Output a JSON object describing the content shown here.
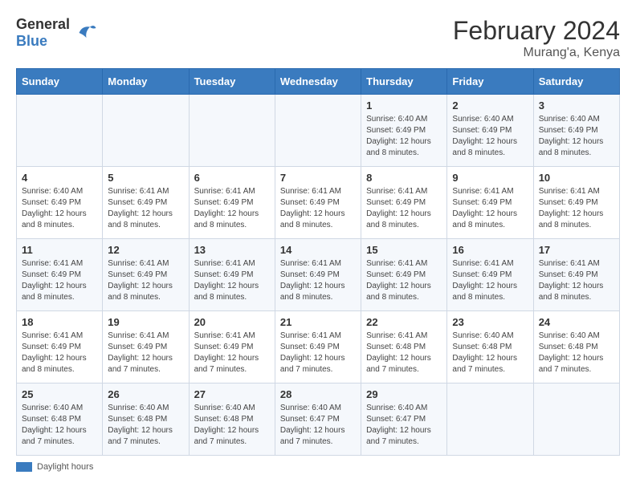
{
  "header": {
    "logo_general": "General",
    "logo_blue": "Blue",
    "title": "February 2024",
    "subtitle": "Murang'a, Kenya"
  },
  "days_of_week": [
    "Sunday",
    "Monday",
    "Tuesday",
    "Wednesday",
    "Thursday",
    "Friday",
    "Saturday"
  ],
  "weeks": [
    [
      {
        "day": "",
        "info": ""
      },
      {
        "day": "",
        "info": ""
      },
      {
        "day": "",
        "info": ""
      },
      {
        "day": "",
        "info": ""
      },
      {
        "day": "1",
        "info": "Sunrise: 6:40 AM\nSunset: 6:49 PM\nDaylight: 12 hours and 8 minutes."
      },
      {
        "day": "2",
        "info": "Sunrise: 6:40 AM\nSunset: 6:49 PM\nDaylight: 12 hours and 8 minutes."
      },
      {
        "day": "3",
        "info": "Sunrise: 6:40 AM\nSunset: 6:49 PM\nDaylight: 12 hours and 8 minutes."
      }
    ],
    [
      {
        "day": "4",
        "info": "Sunrise: 6:40 AM\nSunset: 6:49 PM\nDaylight: 12 hours and 8 minutes."
      },
      {
        "day": "5",
        "info": "Sunrise: 6:41 AM\nSunset: 6:49 PM\nDaylight: 12 hours and 8 minutes."
      },
      {
        "day": "6",
        "info": "Sunrise: 6:41 AM\nSunset: 6:49 PM\nDaylight: 12 hours and 8 minutes."
      },
      {
        "day": "7",
        "info": "Sunrise: 6:41 AM\nSunset: 6:49 PM\nDaylight: 12 hours and 8 minutes."
      },
      {
        "day": "8",
        "info": "Sunrise: 6:41 AM\nSunset: 6:49 PM\nDaylight: 12 hours and 8 minutes."
      },
      {
        "day": "9",
        "info": "Sunrise: 6:41 AM\nSunset: 6:49 PM\nDaylight: 12 hours and 8 minutes."
      },
      {
        "day": "10",
        "info": "Sunrise: 6:41 AM\nSunset: 6:49 PM\nDaylight: 12 hours and 8 minutes."
      }
    ],
    [
      {
        "day": "11",
        "info": "Sunrise: 6:41 AM\nSunset: 6:49 PM\nDaylight: 12 hours and 8 minutes."
      },
      {
        "day": "12",
        "info": "Sunrise: 6:41 AM\nSunset: 6:49 PM\nDaylight: 12 hours and 8 minutes."
      },
      {
        "day": "13",
        "info": "Sunrise: 6:41 AM\nSunset: 6:49 PM\nDaylight: 12 hours and 8 minutes."
      },
      {
        "day": "14",
        "info": "Sunrise: 6:41 AM\nSunset: 6:49 PM\nDaylight: 12 hours and 8 minutes."
      },
      {
        "day": "15",
        "info": "Sunrise: 6:41 AM\nSunset: 6:49 PM\nDaylight: 12 hours and 8 minutes."
      },
      {
        "day": "16",
        "info": "Sunrise: 6:41 AM\nSunset: 6:49 PM\nDaylight: 12 hours and 8 minutes."
      },
      {
        "day": "17",
        "info": "Sunrise: 6:41 AM\nSunset: 6:49 PM\nDaylight: 12 hours and 8 minutes."
      }
    ],
    [
      {
        "day": "18",
        "info": "Sunrise: 6:41 AM\nSunset: 6:49 PM\nDaylight: 12 hours and 8 minutes."
      },
      {
        "day": "19",
        "info": "Sunrise: 6:41 AM\nSunset: 6:49 PM\nDaylight: 12 hours and 7 minutes."
      },
      {
        "day": "20",
        "info": "Sunrise: 6:41 AM\nSunset: 6:49 PM\nDaylight: 12 hours and 7 minutes."
      },
      {
        "day": "21",
        "info": "Sunrise: 6:41 AM\nSunset: 6:49 PM\nDaylight: 12 hours and 7 minutes."
      },
      {
        "day": "22",
        "info": "Sunrise: 6:41 AM\nSunset: 6:48 PM\nDaylight: 12 hours and 7 minutes."
      },
      {
        "day": "23",
        "info": "Sunrise: 6:40 AM\nSunset: 6:48 PM\nDaylight: 12 hours and 7 minutes."
      },
      {
        "day": "24",
        "info": "Sunrise: 6:40 AM\nSunset: 6:48 PM\nDaylight: 12 hours and 7 minutes."
      }
    ],
    [
      {
        "day": "25",
        "info": "Sunrise: 6:40 AM\nSunset: 6:48 PM\nDaylight: 12 hours and 7 minutes."
      },
      {
        "day": "26",
        "info": "Sunrise: 6:40 AM\nSunset: 6:48 PM\nDaylight: 12 hours and 7 minutes."
      },
      {
        "day": "27",
        "info": "Sunrise: 6:40 AM\nSunset: 6:48 PM\nDaylight: 12 hours and 7 minutes."
      },
      {
        "day": "28",
        "info": "Sunrise: 6:40 AM\nSunset: 6:47 PM\nDaylight: 12 hours and 7 minutes."
      },
      {
        "day": "29",
        "info": "Sunrise: 6:40 AM\nSunset: 6:47 PM\nDaylight: 12 hours and 7 minutes."
      },
      {
        "day": "",
        "info": ""
      },
      {
        "day": "",
        "info": ""
      }
    ]
  ],
  "footer": {
    "color_label": "Daylight hours"
  }
}
